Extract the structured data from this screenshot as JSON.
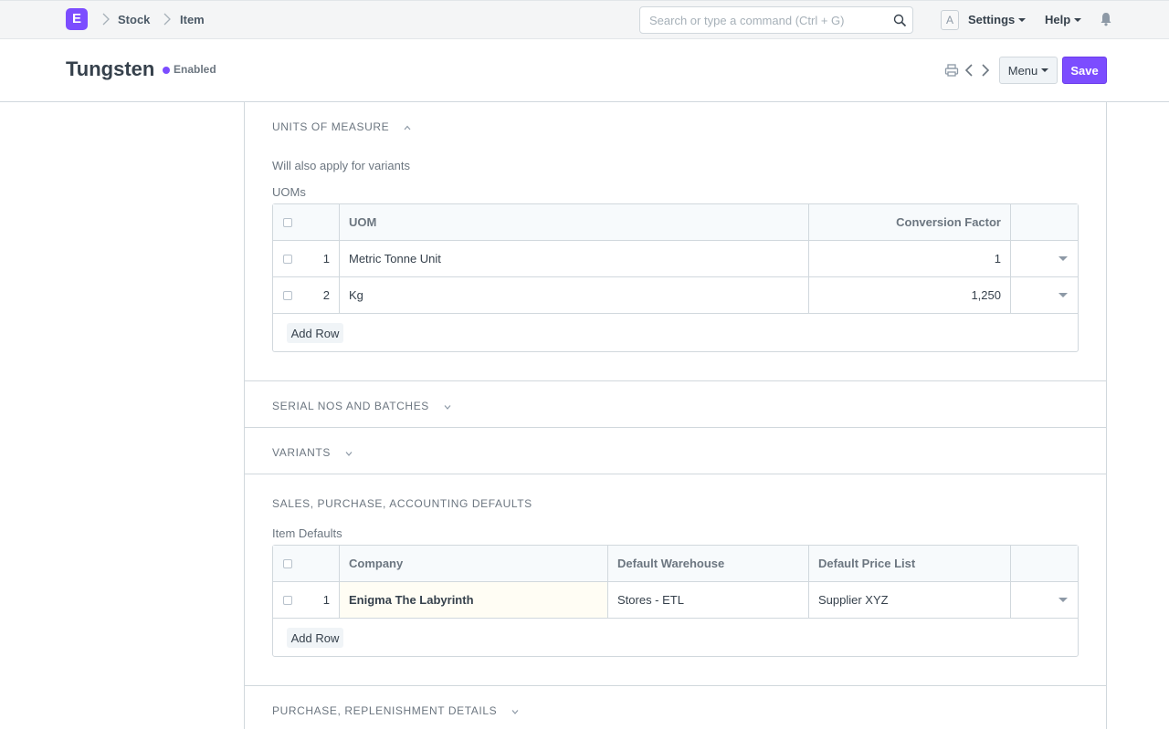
{
  "navbar": {
    "logo_letter": "E",
    "breadcrumbs": [
      "Stock",
      "Item"
    ],
    "search_placeholder": "Search or type a command (Ctrl + G)",
    "avatar_letter": "A",
    "settings_label": "Settings",
    "help_label": "Help"
  },
  "page": {
    "title": "Tungsten",
    "status": "Enabled",
    "status_color": "#7c4dff",
    "menu_label": "Menu",
    "save_label": "Save"
  },
  "sections": {
    "uom": {
      "title": "Units of Measure",
      "note": "Will also apply for variants",
      "grid_label": "UOMs",
      "columns": [
        "UOM",
        "Conversion Factor"
      ],
      "rows": [
        {
          "idx": "1",
          "uom": "Metric Tonne Unit",
          "factor": "1"
        },
        {
          "idx": "2",
          "uom": "Kg",
          "factor": "1,250"
        }
      ],
      "add_row_label": "Add Row"
    },
    "serial": {
      "title": "Serial Nos and Batches"
    },
    "variants": {
      "title": "Variants"
    },
    "defaults": {
      "title": "Sales, Purchase, Accounting Defaults",
      "grid_label": "Item Defaults",
      "columns": [
        "Company",
        "Default Warehouse",
        "Default Price List"
      ],
      "rows": [
        {
          "idx": "1",
          "company": "Enigma The Labyrinth",
          "warehouse": "Stores - ETL",
          "price_list": "Supplier XYZ"
        }
      ],
      "add_row_label": "Add Row"
    },
    "purchase": {
      "title": "Purchase, Replenishment Details"
    }
  },
  "icons": [
    "search-icon",
    "bell-icon",
    "print-icon",
    "prev-icon",
    "next-icon",
    "chevron-up-icon",
    "chevron-down-icon"
  ],
  "colors": {
    "accent": "#7c4dff",
    "border": "#d1d8dd",
    "navbar_bg": "#f4f5f6"
  }
}
